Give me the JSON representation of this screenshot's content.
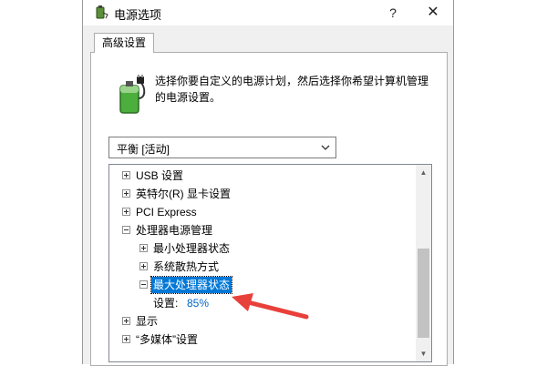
{
  "window": {
    "title": "电源选项",
    "help_label": "?",
    "close_label": "✕"
  },
  "tab": {
    "label": "高级设置"
  },
  "description": "选择你要自定义的电源计划，然后选择你希望计算机管理的电源设置。",
  "plan_select": {
    "value": "平衡 [活动]"
  },
  "tree": {
    "items": [
      {
        "label": "USB 设置",
        "state": "collapsed"
      },
      {
        "label": "英特尔(R) 显卡设置",
        "state": "collapsed"
      },
      {
        "label": "PCI Express",
        "state": "collapsed"
      },
      {
        "label": "处理器电源管理",
        "state": "expanded"
      },
      {
        "label": "最小处理器状态",
        "state": "collapsed"
      },
      {
        "label": "系统散热方式",
        "state": "collapsed"
      },
      {
        "label": "最大处理器状态",
        "state": "expanded",
        "selected": true
      },
      {
        "label": "显示",
        "state": "collapsed"
      },
      {
        "label": "“多媒体”设置",
        "state": "collapsed"
      }
    ],
    "setting": {
      "label": "设置:",
      "value": "85%"
    }
  },
  "colors": {
    "selection": "#0078d7",
    "setting_value": "#0066cc",
    "annotation_arrow": "#e8403a",
    "battery_green": "#4caf3d"
  },
  "icons": [
    "power-options-icon",
    "battery-plug-icon",
    "chevron-down-icon",
    "scroll-up-icon",
    "scroll-down-icon"
  ]
}
